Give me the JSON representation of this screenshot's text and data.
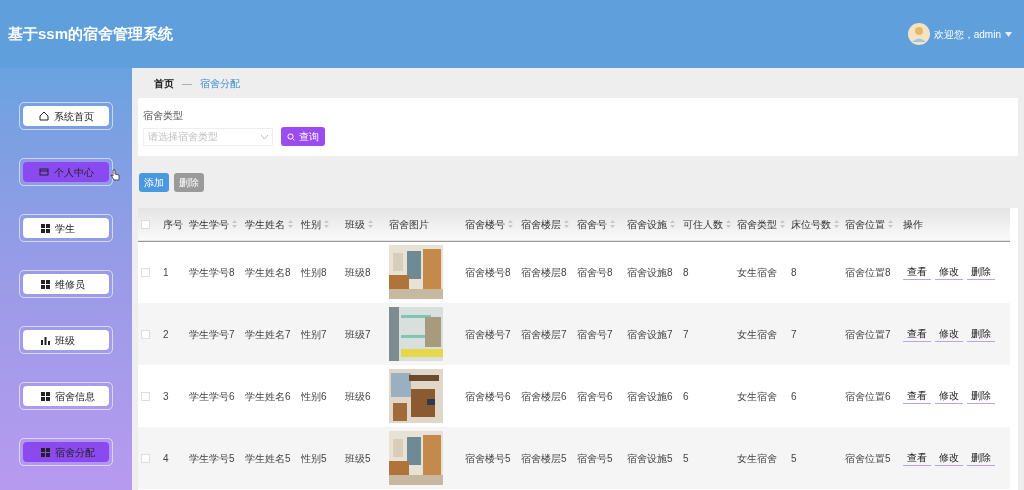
{
  "header": {
    "title": "基于ssm的宿舍管理系统",
    "user": "欢迎您，admin"
  },
  "sidebar": {
    "items": [
      {
        "label": "系统首页",
        "kind": "home",
        "selected": false,
        "hovered": false
      },
      {
        "label": "个人中心",
        "kind": "card",
        "selected": true,
        "hovered": true
      },
      {
        "label": "学生",
        "kind": "grid",
        "selected": false,
        "hovered": false
      },
      {
        "label": "维修员",
        "kind": "grid",
        "selected": false,
        "hovered": false
      },
      {
        "label": "班级",
        "kind": "bars",
        "selected": false,
        "hovered": false
      },
      {
        "label": "宿舍信息",
        "kind": "grid",
        "selected": false,
        "hovered": false
      },
      {
        "label": "宿舍分配",
        "kind": "grid",
        "selected": true,
        "hovered": false
      }
    ]
  },
  "breadcrumb": [
    "首页",
    "—",
    "宿舍分配"
  ],
  "search": {
    "label": "宿舍类型",
    "placeholder": "请选择宿舍类型",
    "button": "查询"
  },
  "actions": [
    "添加",
    "删除"
  ],
  "table": {
    "all_checked": false,
    "columns": [
      {
        "label": "序号",
        "sortable": false
      },
      {
        "label": "学生学号",
        "sortable": true
      },
      {
        "label": "学生姓名",
        "sortable": true
      },
      {
        "label": "性别",
        "sortable": true
      },
      {
        "label": "班级",
        "sortable": true
      },
      {
        "label": "宿舍图片",
        "sortable": false
      },
      {
        "label": "宿舍楼号",
        "sortable": true
      },
      {
        "label": "宿舍楼层",
        "sortable": true
      },
      {
        "label": "宿舍号",
        "sortable": true
      },
      {
        "label": "宿舍设施",
        "sortable": true
      },
      {
        "label": "可住人数",
        "sortable": true
      },
      {
        "label": "宿舍类型",
        "sortable": true
      },
      {
        "label": "床位号数",
        "sortable": true
      },
      {
        "label": "宿舍位置",
        "sortable": true
      },
      {
        "label": "操作",
        "sortable": false
      }
    ],
    "rows": [
      {
        "checked": false,
        "cells": [
          "1",
          "学生学号8",
          "学生姓名8",
          "性别8",
          "班级8",
          {
            "kind": "picture"
          },
          "宿舍楼号8",
          "宿舍楼层8",
          "宿舍号8",
          "宿舍设施8",
          "8",
          "女生宿舍",
          "8",
          "宿舍位置8",
          [
            "查看",
            "修改",
            "删除"
          ]
        ]
      },
      {
        "checked": false,
        "cells": [
          "2",
          "学生学号7",
          "学生姓名7",
          "性别7",
          "班级7",
          {
            "kind": "picture"
          },
          "宿舍楼号7",
          "宿舍楼层7",
          "宿舍号7",
          "宿舍设施7",
          "7",
          "女生宿舍",
          "7",
          "宿舍位置7",
          [
            "查看",
            "修改",
            "删除"
          ]
        ]
      },
      {
        "checked": false,
        "cells": [
          "3",
          "学生学号6",
          "学生姓名6",
          "性别6",
          "班级6",
          {
            "kind": "picture"
          },
          "宿舍楼号6",
          "宿舍楼层6",
          "宿舍号6",
          "宿舍设施6",
          "6",
          "女生宿舍",
          "6",
          "宿舍位置6",
          [
            "查看",
            "修改",
            "删除"
          ]
        ]
      },
      {
        "checked": false,
        "cells": [
          "4",
          "学生学号5",
          "学生姓名5",
          "性别5",
          "班级5",
          {
            "kind": "picture"
          },
          "宿舍楼号5",
          "宿舍楼层5",
          "宿舍号5",
          "宿舍设施5",
          "5",
          "女生宿舍",
          "5",
          "宿舍位置5",
          [
            "查看",
            "修改",
            "删除"
          ]
        ]
      }
    ]
  }
}
